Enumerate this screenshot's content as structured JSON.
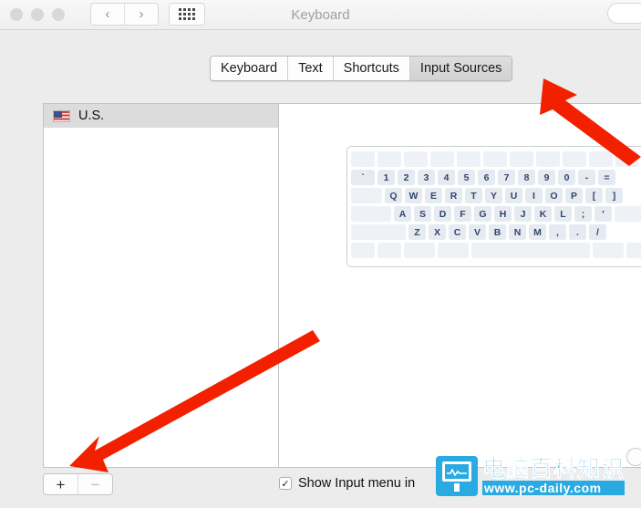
{
  "window": {
    "title": "Keyboard",
    "traffic_lights": [
      "close-button",
      "minimize-button",
      "maximize-button"
    ],
    "nav_back": "‹",
    "nav_forward": "›",
    "show_all_icon": "grid-icon",
    "search_placeholder": ""
  },
  "tabs": [
    {
      "label": "Keyboard",
      "active": false
    },
    {
      "label": "Text",
      "active": false
    },
    {
      "label": "Shortcuts",
      "active": false
    },
    {
      "label": "Input Sources",
      "active": true
    }
  ],
  "input_sources": {
    "items": [
      {
        "label": "U.S.",
        "flag": "us-flag-icon",
        "selected": true
      }
    ]
  },
  "keyboard_preview": {
    "rows": [
      [
        "",
        "",
        "",
        "",
        "",
        "",
        "",
        "",
        "",
        "",
        ""
      ],
      [
        "`",
        "1",
        "2",
        "3",
        "4",
        "5",
        "6",
        "7",
        "8",
        "9",
        "0",
        "-",
        "="
      ],
      [
        "",
        "Q",
        "W",
        "E",
        "R",
        "T",
        "Y",
        "U",
        "I",
        "O",
        "P",
        "[",
        "]"
      ],
      [
        "",
        "A",
        "S",
        "D",
        "F",
        "G",
        "H",
        "J",
        "K",
        "L",
        ";",
        "'",
        ""
      ],
      [
        "",
        "Z",
        "X",
        "C",
        "V",
        "B",
        "N",
        "M",
        ",",
        ".",
        "/",
        ""
      ],
      [
        "",
        "",
        "",
        "",
        "",
        "",
        "",
        ""
      ]
    ]
  },
  "bottom": {
    "add_label": "+",
    "remove_label": "−",
    "show_input_menu_label": "Show Input menu in",
    "checkbox_checked": true,
    "check_glyph": "✓",
    "help_label": "?"
  },
  "annotations": {
    "arrow_1": "arrow pointing to Input Sources tab",
    "arrow_2": "arrow pointing to add input source button",
    "color": "#f32000"
  },
  "watermark": {
    "cn_text": "电脑百科知识",
    "url_text": "www.pc-daily.com",
    "color": "#29abe2"
  }
}
